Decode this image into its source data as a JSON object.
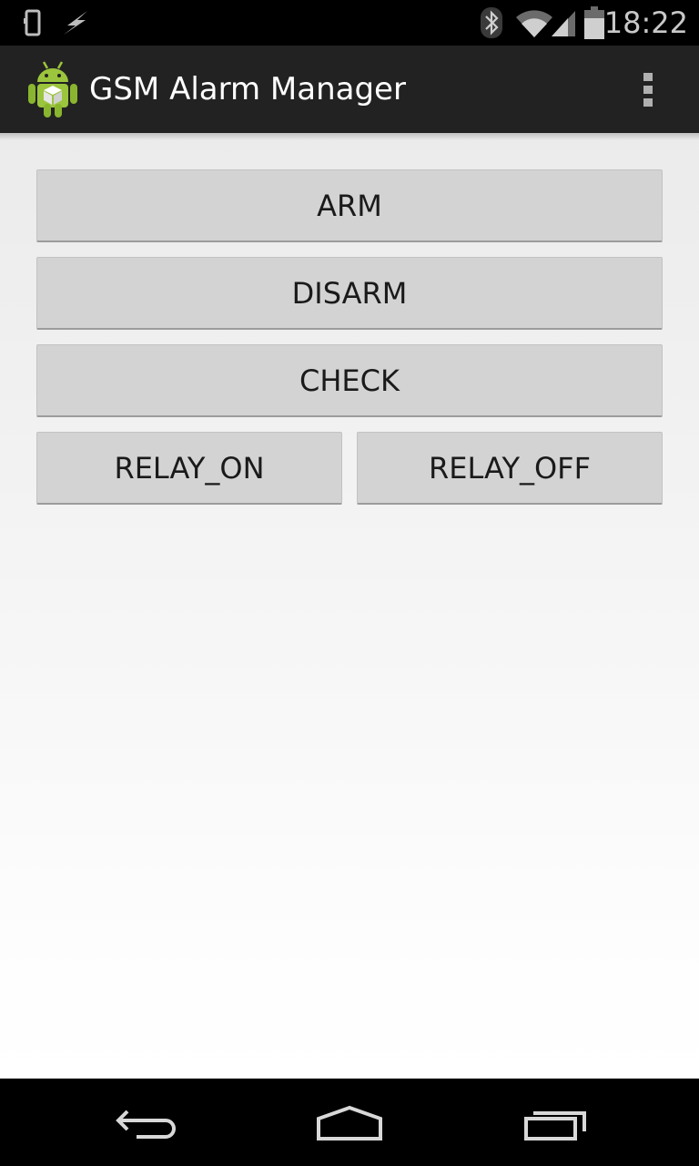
{
  "status_bar": {
    "time": "18:22",
    "icons": [
      "phone-storage-icon",
      "usb-lightning-icon",
      "bluetooth-icon",
      "wifi-icon",
      "cell-signal-icon",
      "battery-icon"
    ]
  },
  "action_bar": {
    "title": "GSM Alarm Manager",
    "app_icon": "android-app-icon",
    "overflow_icon": "overflow-menu-icon"
  },
  "buttons": {
    "arm": "ARM",
    "disarm": "DISARM",
    "check": "CHECK",
    "relay_on": "RELAY_ON",
    "relay_off": "RELAY_OFF"
  },
  "nav_bar": {
    "icons": [
      "back-icon",
      "home-icon",
      "recents-icon"
    ]
  },
  "colors": {
    "status_bar": "#000000",
    "action_bar": "#222222",
    "button": "#d3d3d3",
    "button_text": "#1a1a1a",
    "nav_bar": "#000000"
  }
}
